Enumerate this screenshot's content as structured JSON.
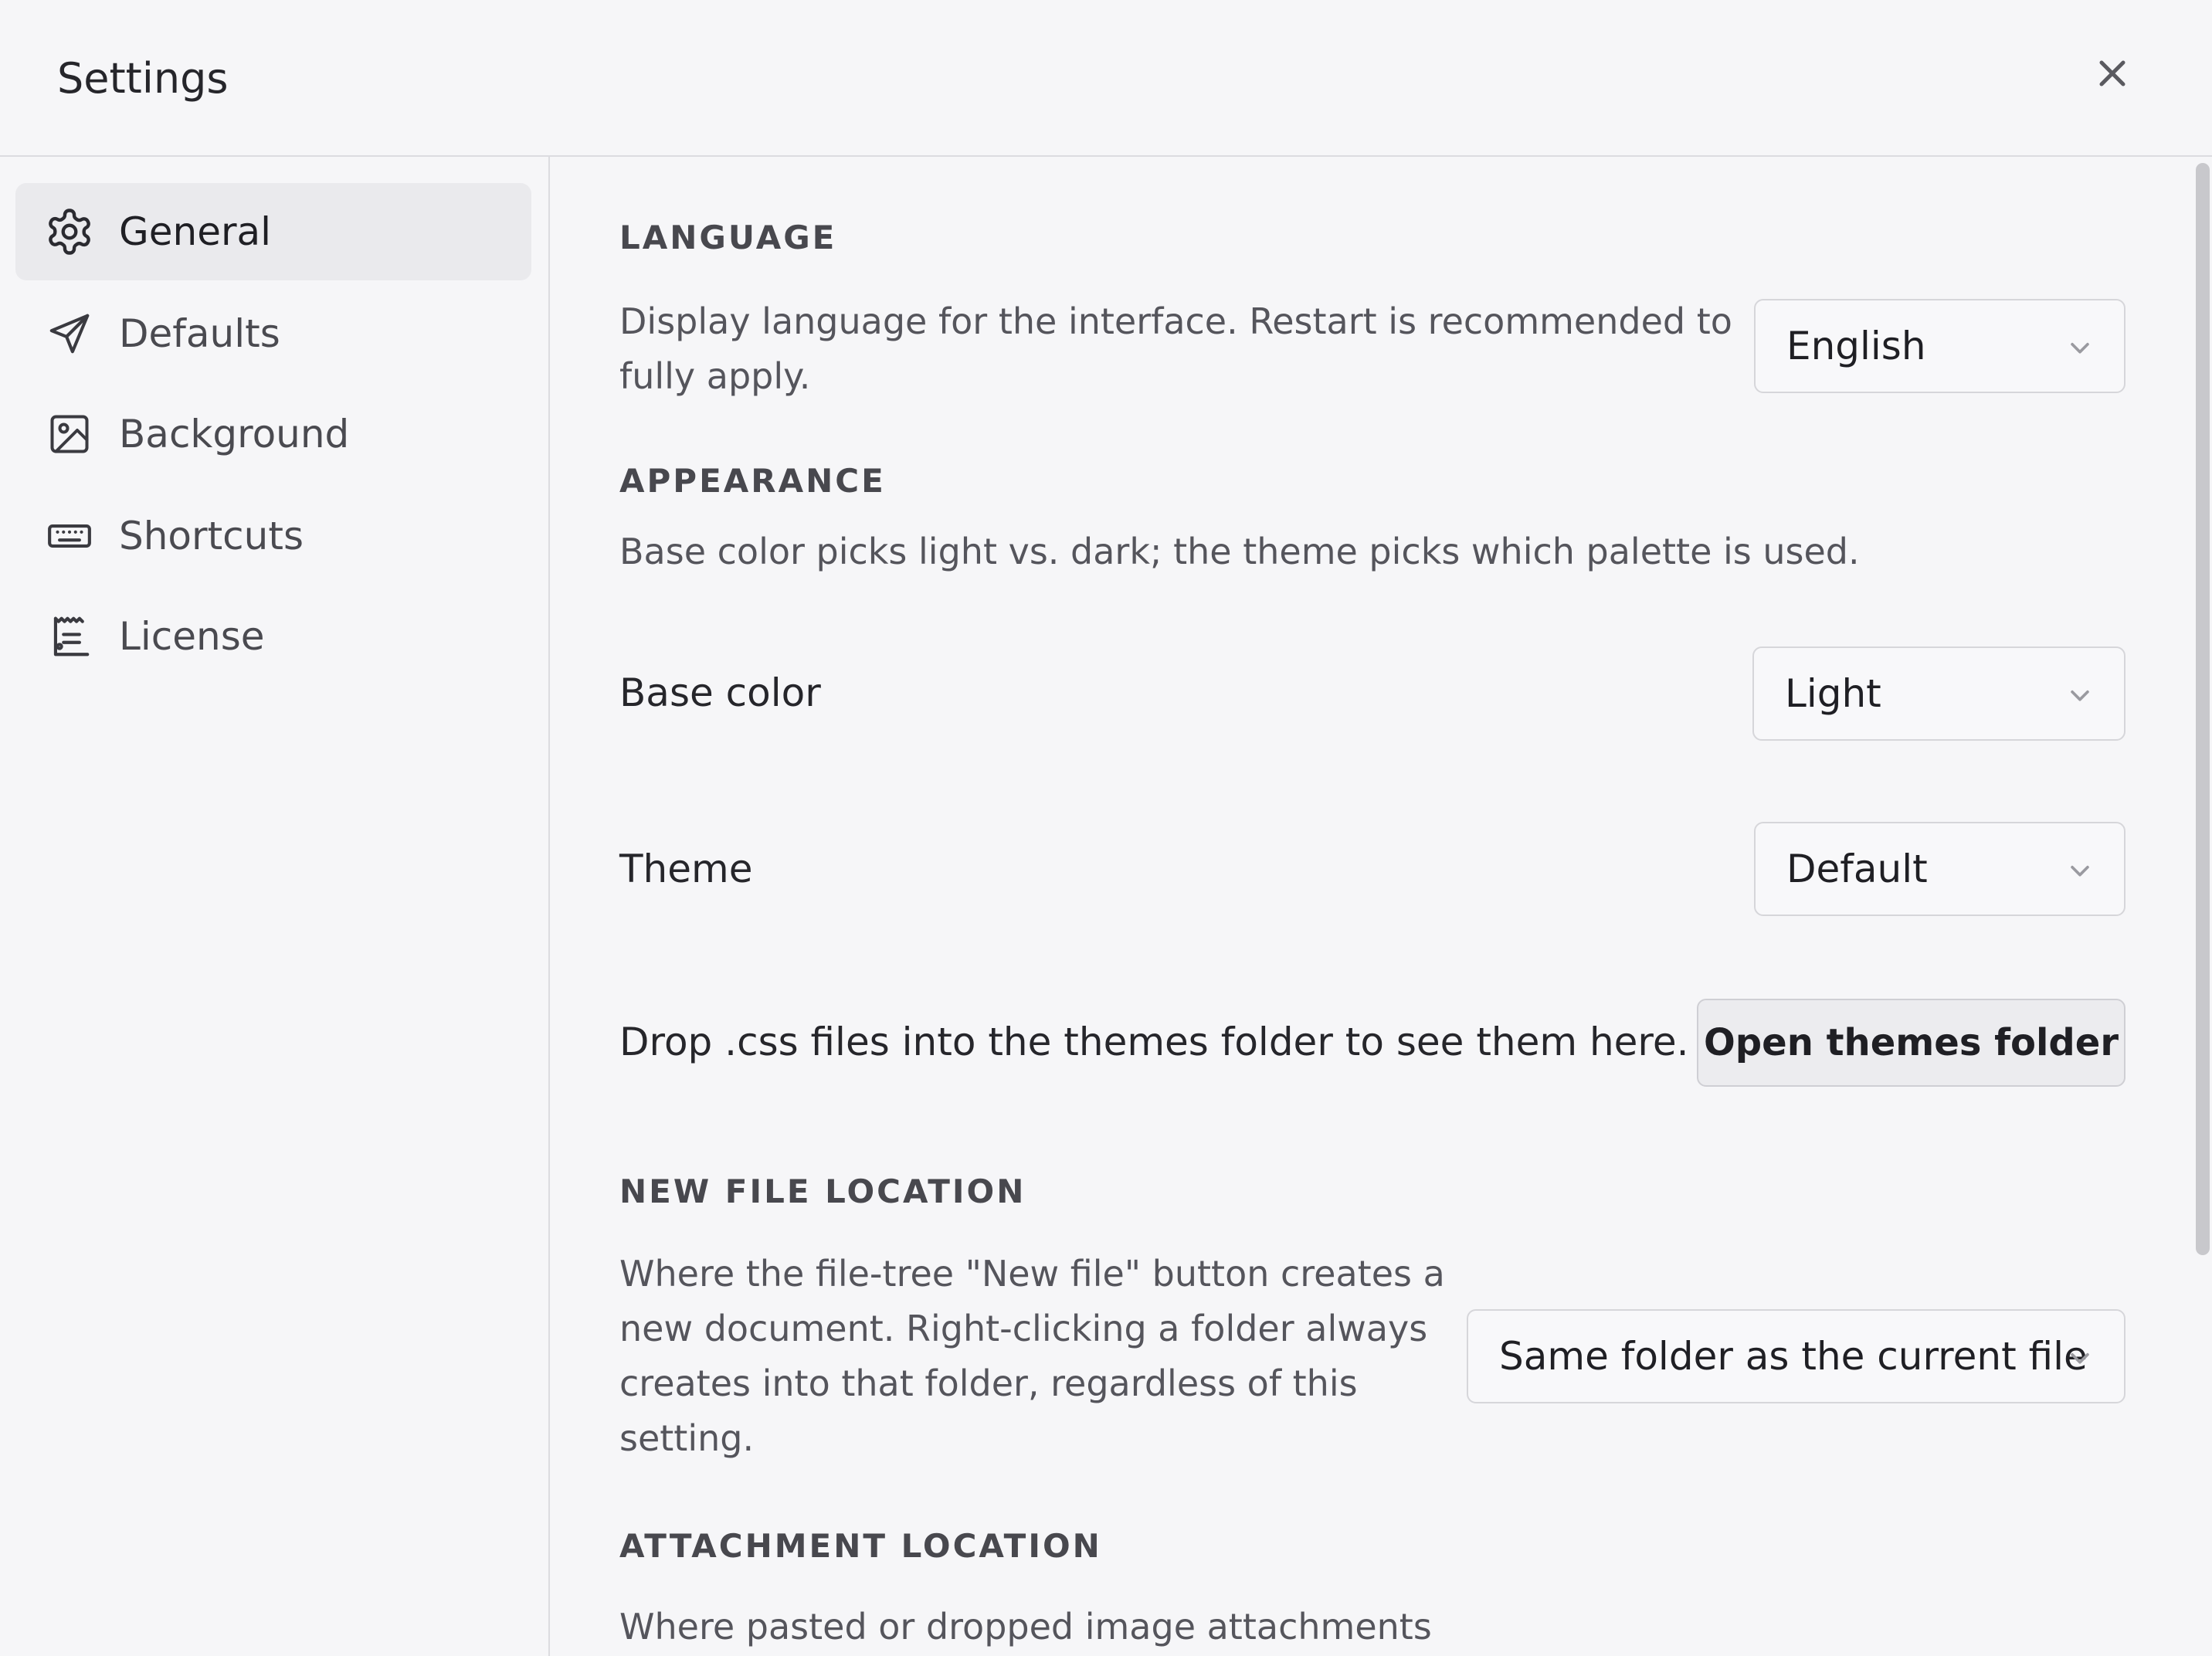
{
  "window": {
    "title": "Settings",
    "close_icon": "close-icon"
  },
  "sidebar": {
    "items": [
      {
        "label": "General",
        "icon": "gear-icon",
        "active": true
      },
      {
        "label": "Defaults",
        "icon": "send-icon",
        "active": false
      },
      {
        "label": "Background",
        "icon": "image-icon",
        "active": false
      },
      {
        "label": "Shortcuts",
        "icon": "keyboard-icon",
        "active": false
      },
      {
        "label": "License",
        "icon": "receipt-icon",
        "active": false
      }
    ]
  },
  "language": {
    "heading": "LANGUAGE",
    "description_line1": "Display language for the interface. Restart is recommended to",
    "description_line2": "fully apply.",
    "selected": "English"
  },
  "appearance": {
    "heading": "APPEARANCE",
    "description": "Base color picks light vs. dark; the theme picks which palette is used.",
    "base_color_label": "Base color",
    "base_color_value": "Light",
    "theme_label": "Theme",
    "theme_value": "Default",
    "themes_hint": "Drop .css files into the themes folder to see them here.",
    "open_themes_button": "Open themes folder"
  },
  "new_file_location": {
    "heading": "NEW FILE LOCATION",
    "description_line1": "Where the file-tree \"New file\" button creates a",
    "description_line2": "new document. Right-clicking a folder always",
    "description_line3": "creates into that folder, regardless of this",
    "description_line4": "setting.",
    "selected": "Same folder as the current file"
  },
  "attachment_location": {
    "heading": "ATTACHMENT LOCATION",
    "description_line1": "Where pasted or dropped image attachments"
  }
}
